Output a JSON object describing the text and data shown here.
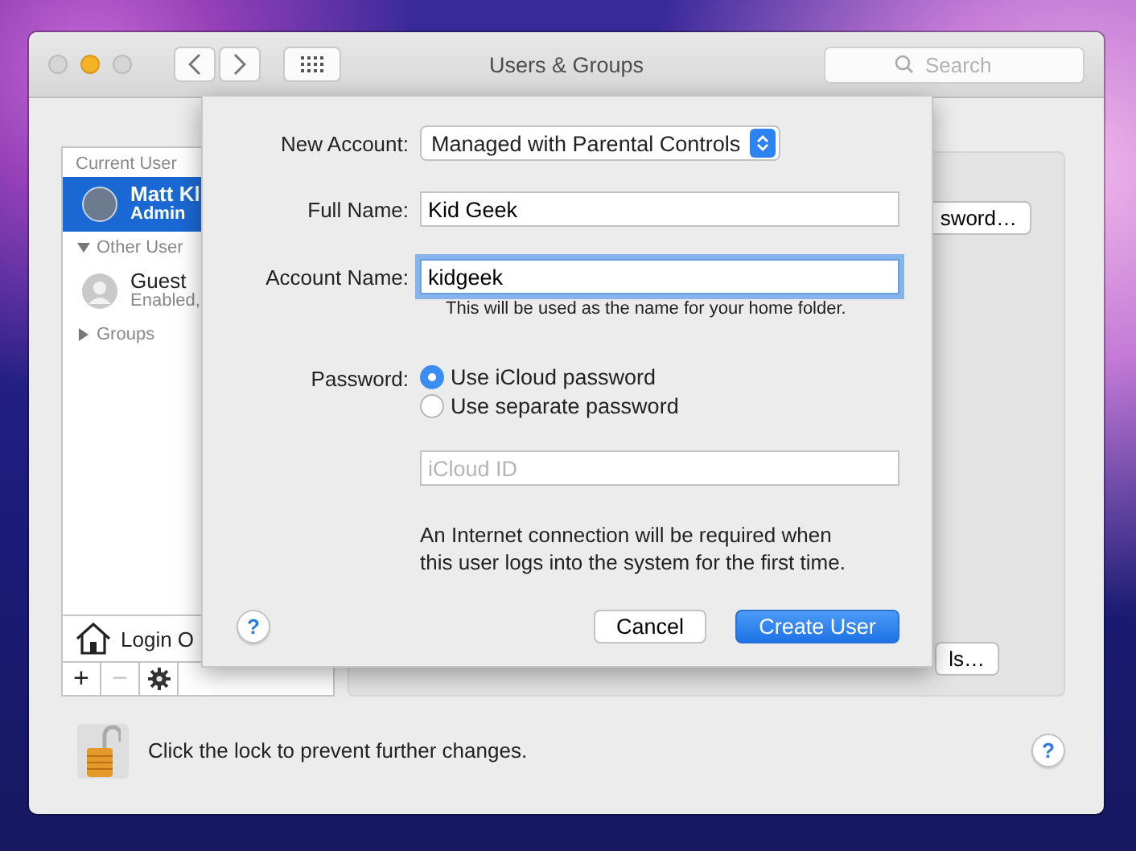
{
  "window": {
    "title": "Users & Groups",
    "search": {
      "placeholder": "Search"
    }
  },
  "sidebar": {
    "items": [
      {
        "kind": "header",
        "label": "Current User"
      },
      {
        "kind": "user",
        "name": "Matt Kl",
        "detail": "Admin",
        "avatar": {
          "kind": "photo"
        },
        "selected": true
      },
      {
        "kind": "group",
        "label": "Other User",
        "expanded": true
      },
      {
        "kind": "user",
        "name": "Guest",
        "detail": "Enabled,",
        "avatar": {
          "kind": "silhouette"
        },
        "selected": false
      },
      {
        "kind": "group",
        "label": "Groups",
        "expanded": false
      }
    ],
    "login_options": "Login O",
    "buttons": [
      {
        "label": "+",
        "disabled": false
      },
      {
        "label": "−",
        "disabled": true
      }
    ]
  },
  "panel": {
    "buttons": [
      "sword…",
      "ls…"
    ]
  },
  "sheet": {
    "new_account": {
      "label": "New Account:",
      "value": "Managed with Parental Controls"
    },
    "full_name": {
      "label": "Full Name:",
      "value": "Kid Geek",
      "focused": false
    },
    "account_name": {
      "label": "Account Name:",
      "value": "kidgeek",
      "focused": true,
      "hint": "This will be used as the name for your home folder."
    },
    "password": {
      "label": "Password:",
      "options": [
        {
          "label": "Use iCloud password",
          "selected": true
        },
        {
          "label": "Use separate password",
          "selected": false
        }
      ]
    },
    "icloud_id": {
      "placeholder": "iCloud ID"
    },
    "message": "An Internet connection will be required when this user logs into the system for the first time.",
    "help": "?",
    "buttons": [
      {
        "label": "Cancel",
        "default": false
      },
      {
        "label": "Create User",
        "default": true
      }
    ]
  },
  "footer": {
    "lock_text": "Click the lock to prevent further changes.",
    "help": "?"
  }
}
